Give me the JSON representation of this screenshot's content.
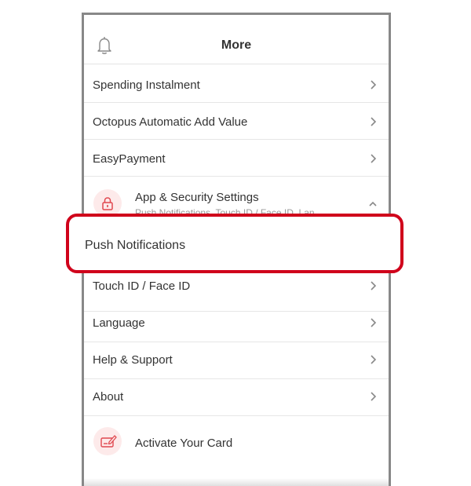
{
  "header": {
    "title": "More",
    "bell_icon": "bell-icon"
  },
  "menu": {
    "items": [
      {
        "label": "Spending Instalment"
      },
      {
        "label": "Octopus Automatic Add Value"
      },
      {
        "label": "EasyPayment"
      }
    ],
    "security": {
      "label": "App & Security Settings",
      "sublabel": "Push Notifications, Touch ID / Face ID, Lan...",
      "icon": "lock-icon",
      "expanded": true
    },
    "highlighted": {
      "label": "Push Notifications"
    },
    "items_after": [
      {
        "label": "Touch ID / Face ID"
      },
      {
        "label": "Language"
      },
      {
        "label": "Help & Support"
      },
      {
        "label": "About"
      }
    ],
    "activate": {
      "label": "Activate Your Card",
      "icon": "card-edit-icon"
    }
  },
  "colors": {
    "accent": "#d0021b",
    "icon_bg": "#fdeaea",
    "icon": "#e0484f"
  }
}
